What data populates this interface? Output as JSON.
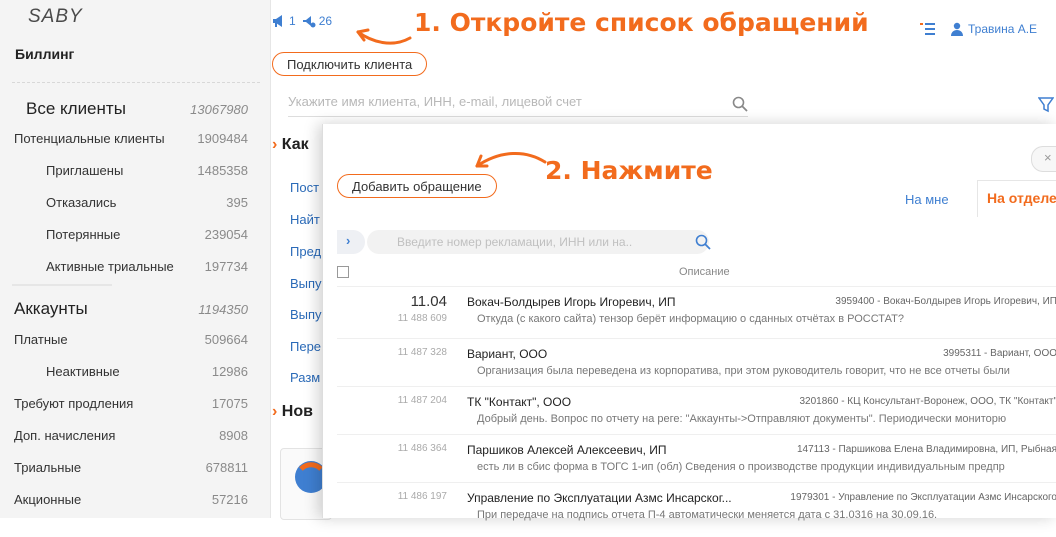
{
  "sidebar": {
    "logo": "SABY",
    "section": "Биллинг",
    "groups": [
      {
        "label": "Все клиенты",
        "count": "13067980"
      },
      {
        "label": "Аккаунты",
        "count": "1194350"
      }
    ],
    "items": [
      {
        "label": "Потенциальные клиенты",
        "count": "1909484"
      },
      {
        "label": "Приглашены",
        "count": "1485358"
      },
      {
        "label": "Отказались",
        "count": "395"
      },
      {
        "label": "Потерянные",
        "count": "239054"
      },
      {
        "label": "Активные триальные",
        "count": "197734"
      },
      {
        "label": "Платные",
        "count": "509664"
      },
      {
        "label": "Неактивные",
        "count": "12986"
      },
      {
        "label": "Требуют продления",
        "count": "17075"
      },
      {
        "label": "Доп. начисления",
        "count": "8908"
      },
      {
        "label": "Триальные",
        "count": "678811"
      },
      {
        "label": "Акционные",
        "count": "57216"
      }
    ]
  },
  "header": {
    "count1": "1",
    "count2": "26",
    "annotation1": "1. Откройте список обращений",
    "connect_button": "Подключить клиента",
    "user_name": "Травина А.Е",
    "search_placeholder": "Укажите имя клиента, ИНН, e-mail, лицевой счет"
  },
  "main": {
    "section1": "Как",
    "links": [
      "Пост",
      "Найт",
      "Пред",
      "Выпу",
      "Выпу",
      "Пере",
      "Разм"
    ],
    "section2": "Нов"
  },
  "modal": {
    "add_button": "Добавить обращение",
    "annotation2": "2. Нажмите",
    "tab_mine": "На мне",
    "tab_dept": "На отделе",
    "search_placeholder": "Введите номер рекламации, ИНН или на..",
    "col_description": "Описание",
    "rows": [
      {
        "date": "11.04",
        "number": "11 488 609",
        "name": "Вокач-Болдырев Игорь Игоревич, ИП",
        "right": "3959400 - Вокач-Болдырев Игорь Игоревич, ИП",
        "desc": "Откуда (с какого сайта) тензор берёт информацию о сданных отчётах в РОССТАТ?"
      },
      {
        "date": "",
        "number": "11 487 328",
        "name": "Вариант, ООО",
        "right": "3995311 - Вариант, ООО",
        "desc": "Организация была переведена из корпоратива, при этом руководитель говорит, что не все отчеты были"
      },
      {
        "date": "",
        "number": "11 487 204",
        "name": "ТК \"Контакт\", ООО",
        "right": "3201860 - КЦ Консультант-Воронеж, ООО, ТК \"Контакт\"",
        "desc": "Добрый день. Вопрос по отчету на реге: \"Аккаунты->Отправляют документы\". Периодически мониторю"
      },
      {
        "date": "",
        "number": "11 486 364",
        "name": "Паршиков Алексей Алексеевич, ИП",
        "right": "147113 - Паршикова Елена Владимировна, ИП, Рыбная",
        "desc": "есть ли в сбис форма в ТОГС 1-ип (обл) Сведения о производстве продукции индивидуальным предпр"
      },
      {
        "date": "",
        "number": "11 486 197",
        "name": "Управление по Эксплуатации Азмс Инсарског...",
        "right": "1979301 - Управление по Эксплуатации Азмс Инсарского",
        "desc": "При передаче на подпись отчета П-4 автоматически меняется дата с 31.0316 на 30.09.16."
      }
    ]
  }
}
